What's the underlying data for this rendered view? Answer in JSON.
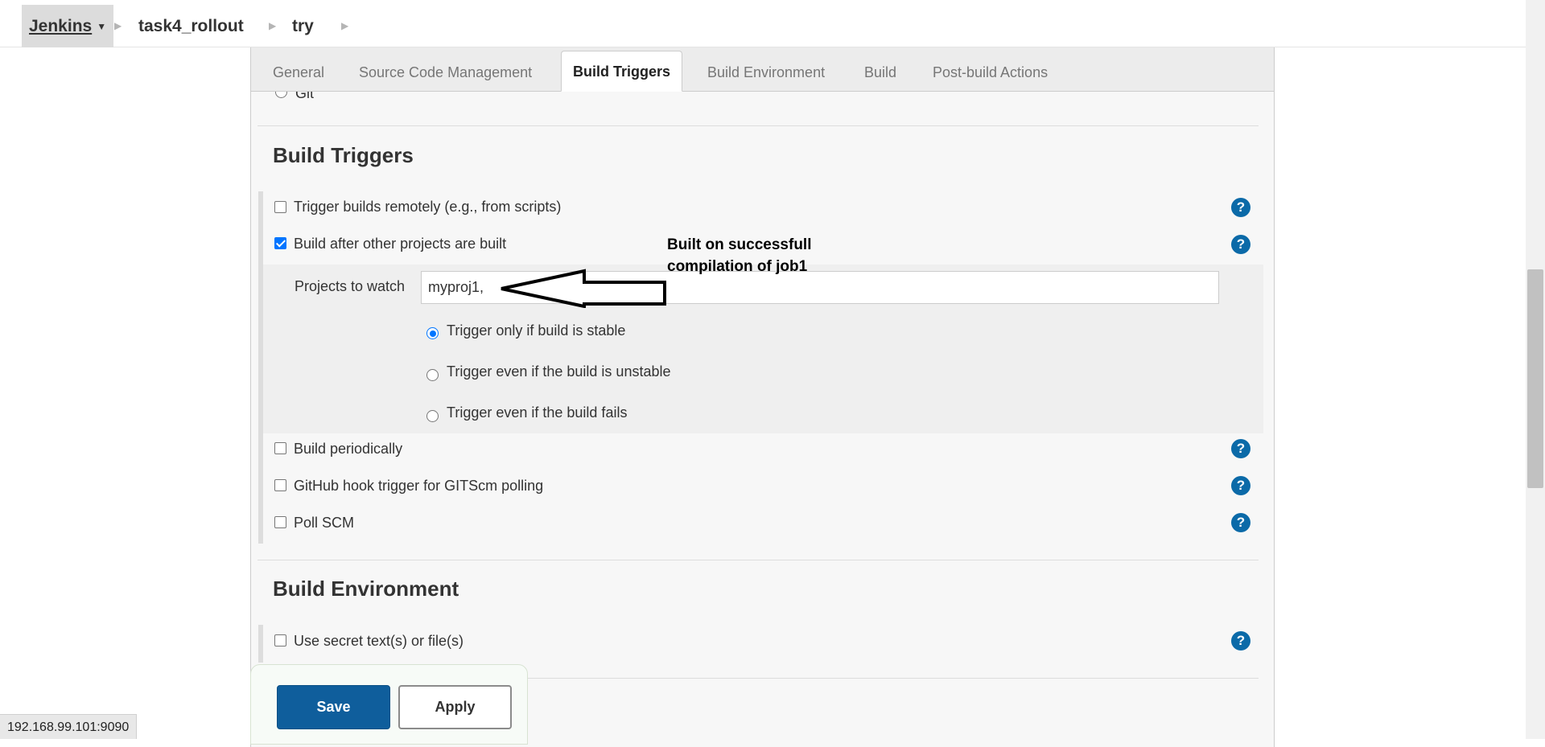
{
  "breadcrumb": {
    "home": "Jenkins",
    "items": [
      "task4_rollout",
      "try"
    ]
  },
  "tabs": [
    {
      "label": "General",
      "active": false
    },
    {
      "label": "Source Code Management",
      "active": false
    },
    {
      "label": "Build Triggers",
      "active": true
    },
    {
      "label": "Build Environment",
      "active": false
    },
    {
      "label": "Build",
      "active": false
    },
    {
      "label": "Post-build Actions",
      "active": false
    }
  ],
  "scm": {
    "partial_option": "Git"
  },
  "build_triggers": {
    "title": "Build Triggers",
    "options": [
      {
        "label": "Trigger builds remotely (e.g., from scripts)",
        "checked": false,
        "help_icon": "help-icon"
      },
      {
        "label": "Build after other projects are built",
        "checked": true,
        "help_icon": "help-icon"
      },
      {
        "label": "Build periodically",
        "checked": false,
        "help_icon": "help-icon"
      },
      {
        "label": "GitHub hook trigger for GITScm polling",
        "checked": false,
        "help_icon": "help-icon"
      },
      {
        "label": "Poll SCM",
        "checked": false,
        "help_icon": "help-icon"
      }
    ],
    "projects_to_watch": {
      "label": "Projects to watch",
      "value": "myproj1,"
    },
    "trigger_conditions": [
      {
        "label": "Trigger only if build is stable",
        "selected": true
      },
      {
        "label": "Trigger even if the build is unstable",
        "selected": false
      },
      {
        "label": "Trigger even if the build fails",
        "selected": false
      }
    ]
  },
  "annotation": {
    "line1": "Built on successfull",
    "line2": "compilation of job1"
  },
  "build_environment": {
    "title": "Build Environment",
    "options": [
      {
        "label": "Use secret text(s) or file(s)",
        "checked": false
      }
    ]
  },
  "buttons": {
    "save": "Save",
    "apply": "Apply"
  },
  "status_bar": {
    "url": "192.168.99.101:9090"
  },
  "colors": {
    "accent": "#0f5e9c",
    "help": "#0b6aa8",
    "checkbox": "#0075ff"
  }
}
